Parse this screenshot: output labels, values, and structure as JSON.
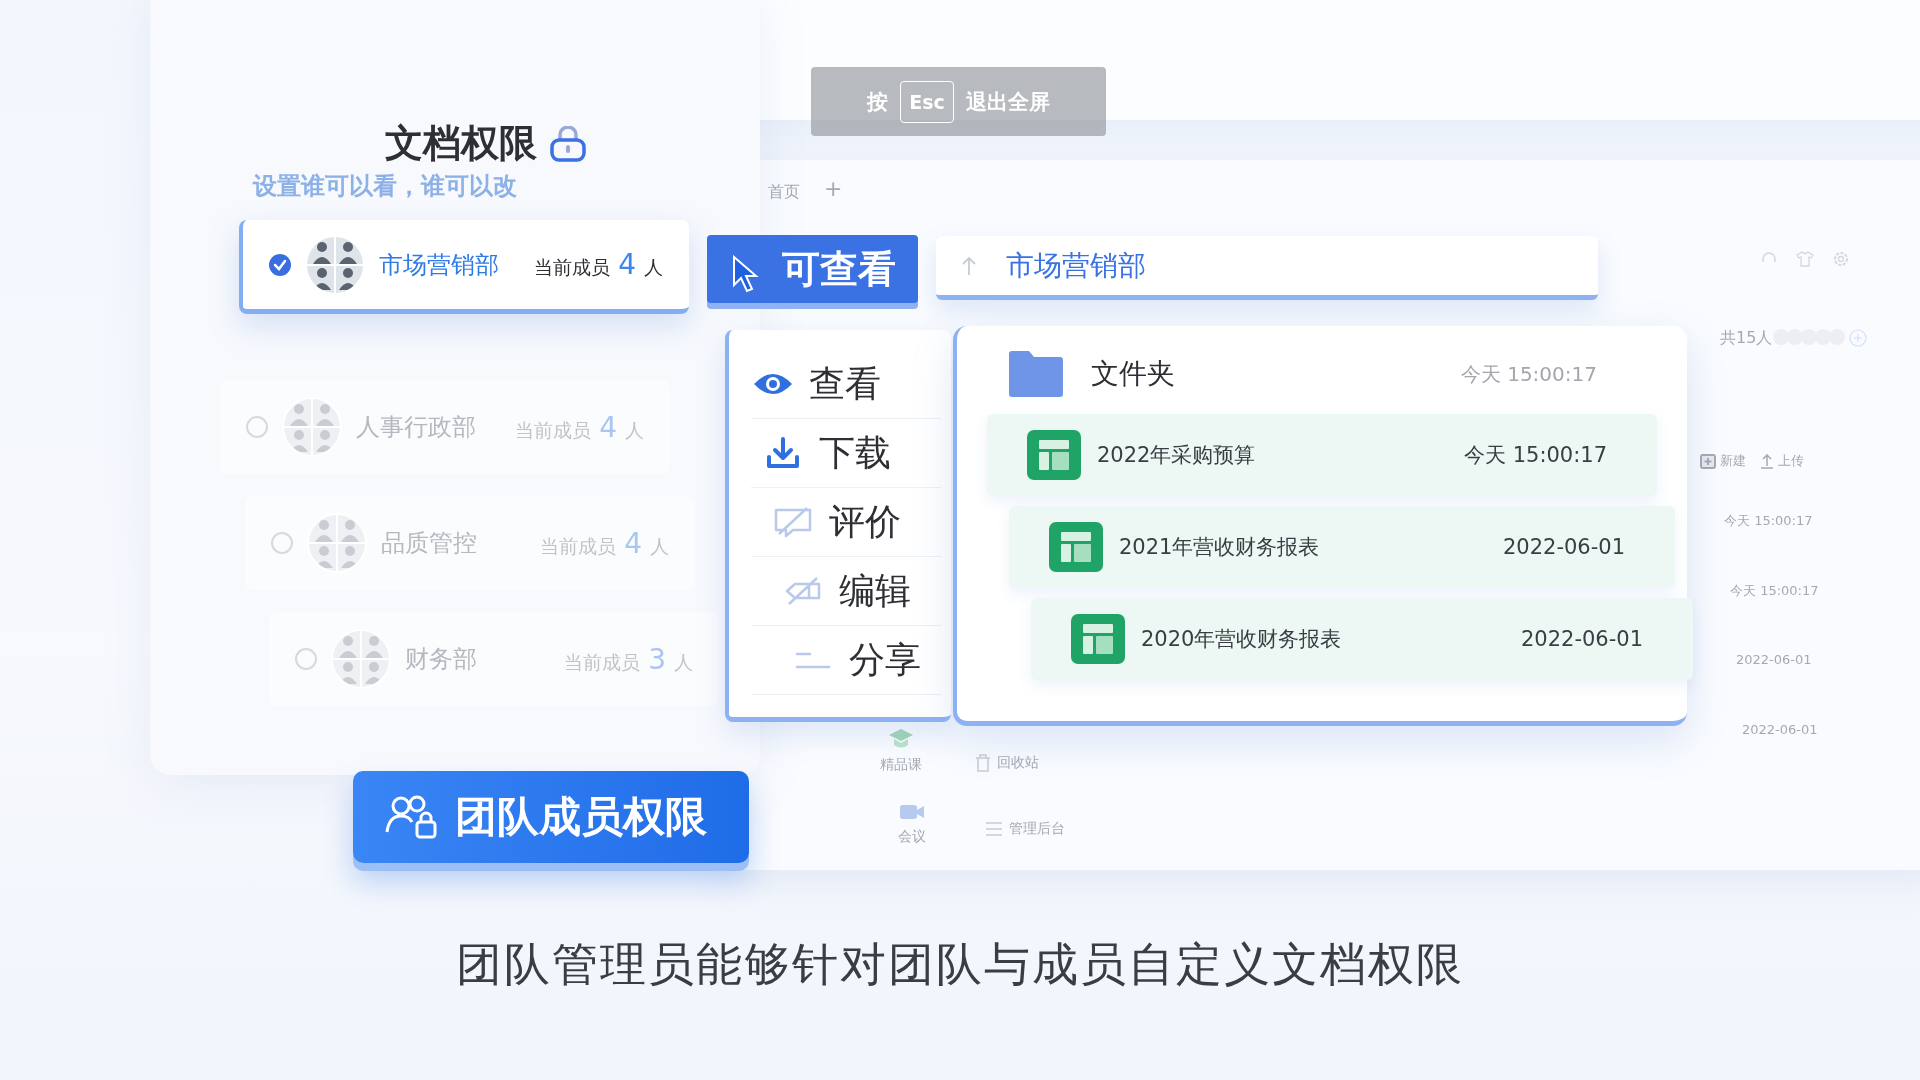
{
  "header": {
    "title": "文档权限",
    "subtitle": "设置谁可以看，谁可以改"
  },
  "departments": [
    {
      "name": "市场营销部",
      "members_label": "当前成员",
      "count": "4",
      "unit": "人",
      "selected": true
    },
    {
      "name": "人事行政部",
      "members_label": "当前成员",
      "count": "4",
      "unit": "人",
      "selected": false
    },
    {
      "name": "品质管控",
      "members_label": "当前成员",
      "count": "4",
      "unit": "人",
      "selected": false
    },
    {
      "name": "财务部",
      "members_label": "当前成员",
      "count": "3",
      "unit": "人",
      "selected": false
    }
  ],
  "team_button": {
    "label": "团队成员权限"
  },
  "esc_hint": {
    "prefix": "按",
    "key": "Esc",
    "suffix": "退出全屏"
  },
  "background_app": {
    "tabs": [
      "首页",
      "+"
    ],
    "member_count": "共15人",
    "toolbar": [
      {
        "kind": "new",
        "label": "新建"
      },
      {
        "kind": "upload",
        "label": "上传"
      }
    ],
    "dates": [
      "今天 15:00:17",
      "今天 15:00:17",
      "2022-06-01",
      "2022-06-01"
    ],
    "sidebar": [
      {
        "kind": "course",
        "label": "精品课"
      },
      {
        "kind": "trash",
        "label": "回收站"
      },
      {
        "kind": "meeting",
        "label": "会议"
      },
      {
        "kind": "admin",
        "label": "管理后台"
      }
    ]
  },
  "access_button": {
    "label": "可查看"
  },
  "breadcrumb": {
    "path": "市场营销部"
  },
  "permissions": [
    {
      "kind": "view",
      "label": "查看",
      "enabled": true
    },
    {
      "kind": "download",
      "label": "下载",
      "enabled": true
    },
    {
      "kind": "comment",
      "label": "评价",
      "enabled": false
    },
    {
      "kind": "edit",
      "label": "编辑",
      "enabled": false
    },
    {
      "kind": "share",
      "label": "分享",
      "enabled": false
    }
  ],
  "files": {
    "folder": {
      "name": "文件夹",
      "time": "今天 15:00:17"
    },
    "items": [
      {
        "name": "2022年采购预算",
        "time": "今天 15:00:17"
      },
      {
        "name": "2021年营收财务报表",
        "time": "2022-06-01"
      },
      {
        "name": "2020年营收财务报表",
        "time": "2022-06-01"
      }
    ]
  },
  "caption": "团队管理员能够针对团队与成员自定义文档权限"
}
